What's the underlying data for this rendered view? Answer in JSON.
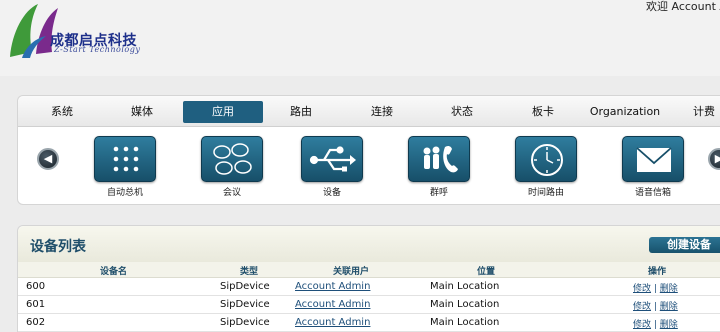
{
  "header": {
    "logo_cn": "成都启点科技",
    "logo_en": "Z-Start Technology",
    "welcome": "欢迎 Account A"
  },
  "tabs": [
    {
      "label": "系统"
    },
    {
      "label": "媒体"
    },
    {
      "label": "应用",
      "active": true
    },
    {
      "label": "路由"
    },
    {
      "label": "连接"
    },
    {
      "label": "状态"
    },
    {
      "label": "板卡"
    },
    {
      "label": "Organization"
    },
    {
      "label": "计费"
    }
  ],
  "apps": [
    {
      "label": "自动总机",
      "icon": "dialpad-icon"
    },
    {
      "label": "会议",
      "icon": "speech-bubbles-icon"
    },
    {
      "label": "设备",
      "icon": "usb-icon"
    },
    {
      "label": "群呼",
      "icon": "group-call-icon"
    },
    {
      "label": "时间路由",
      "icon": "clock-icon"
    },
    {
      "label": "语音信箱",
      "icon": "envelope-icon"
    }
  ],
  "device_list": {
    "title": "设备列表",
    "create_label": "创建设备",
    "columns": [
      "设备名",
      "类型",
      "关联用户",
      "位置",
      "操作"
    ],
    "rows": [
      {
        "name": "600",
        "type": "SipDevice",
        "user": "Account Admin",
        "location": "Main Location",
        "edit": "修改",
        "delete": "删除"
      },
      {
        "name": "601",
        "type": "SipDevice",
        "user": "Account Admin",
        "location": "Main Location",
        "edit": "修改",
        "delete": "删除"
      },
      {
        "name": "602",
        "type": "SipDevice",
        "user": "Account Admin",
        "location": "Main Location",
        "edit": "修改",
        "delete": "删除"
      }
    ]
  },
  "colors": {
    "accent": "#1f5f80",
    "link": "#1e4f7a",
    "logo_text": "#1d2f8a"
  }
}
